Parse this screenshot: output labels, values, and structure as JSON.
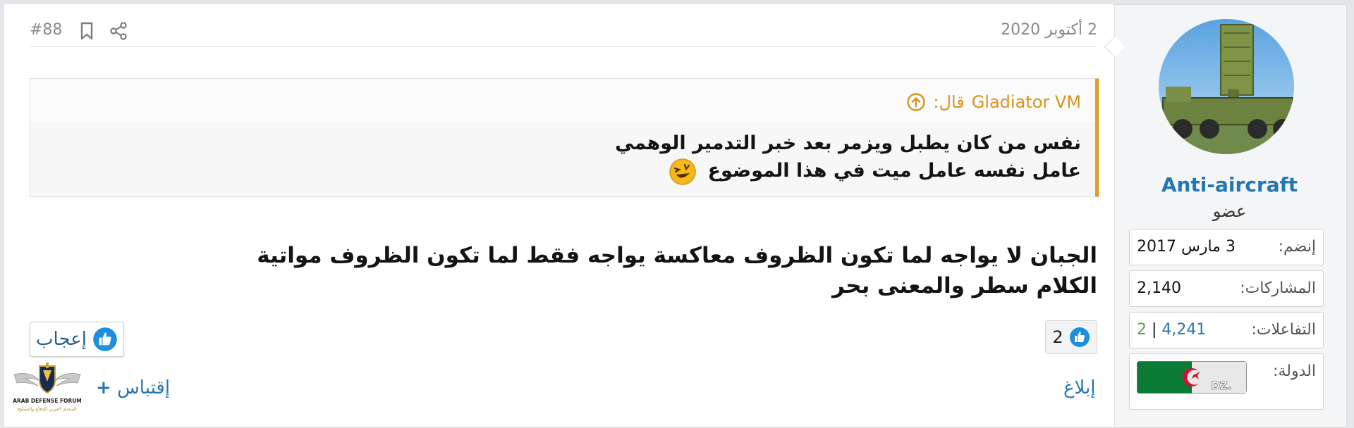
{
  "post": {
    "number": "#88",
    "date": "2 أكتوبر 2020",
    "quote": {
      "author": "Gladiator VM",
      "said": "قال:",
      "line1": "نفس من كان يطبل ويزمر بعد خبر التدمير الوهمي",
      "line2": "عامل نفسه عامل ميت في هذا الموضوع"
    },
    "body": {
      "line1": "الجبان لا يواجه لما تكون الظروف معاكسة يواجه فقط لما تكون الظروف مواتية",
      "line2": "الكلام سطر والمعنى بحر"
    },
    "reaction_count": "2",
    "like_label": "إعجاب",
    "report_label": "إبلاغ",
    "quote_label": "إقتباس",
    "quote_plus": "+"
  },
  "user": {
    "name": "Anti-aircraft",
    "title": "عضو",
    "joined_label": "إنضم:",
    "joined_value": "3 مارس 2017",
    "posts_label": "المشاركات:",
    "posts_value": "2,140",
    "reactions_label": "التفاعلات:",
    "reactions_value": "4,241",
    "reactions_sep": "|",
    "reactions_extra": "2",
    "country_label": "الدولة:",
    "country_flag_text": ".DZ"
  },
  "logo": {
    "line1": "ARAB DEFENSE FORUM",
    "line2": "المنتدى العربي للدفاع والتسليح"
  },
  "colors": {
    "accent_orange": "#e29b1c",
    "link_blue": "#2577b1",
    "green": "#5aa53f"
  },
  "icons": {
    "bookmark": "bookmark-icon",
    "share": "share-icon",
    "quote_up": "arrow-up-circle-icon",
    "like": "thumbs-up-icon",
    "emoji": "laughing-emoji-icon"
  }
}
